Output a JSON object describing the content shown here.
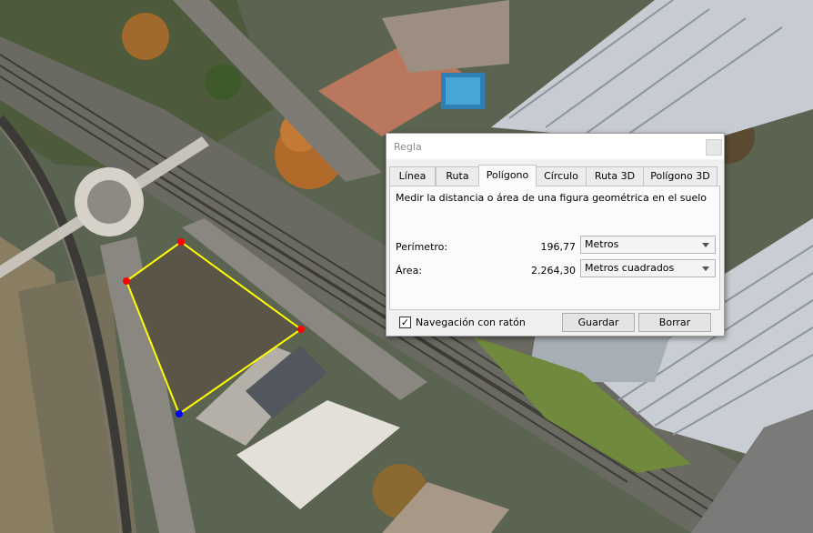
{
  "dialog": {
    "title": "Regla",
    "tabs": [
      {
        "label": "Línea",
        "active": false
      },
      {
        "label": "Ruta",
        "active": false
      },
      {
        "label": "Polígono",
        "active": true
      },
      {
        "label": "Círculo",
        "active": false
      },
      {
        "label": "Ruta 3D",
        "active": false
      },
      {
        "label": "Polígono 3D",
        "active": false
      }
    ],
    "description": "Medir la distancia o área de una figura geométrica en el suelo",
    "perimeter": {
      "label": "Perímetro:",
      "value": "196,77",
      "unit": "Metros"
    },
    "area": {
      "label": "Área:",
      "value": "2.264,30",
      "unit": "Metros cuadrados"
    },
    "mouse_nav": {
      "label": "Navegación con ratón",
      "checked": true
    },
    "save_label": "Guardar",
    "clear_label": "Borrar"
  },
  "polygon": {
    "line_color": "#ffff00",
    "vertex_color": "#ff0000",
    "last_vertex_color": "#0000ff"
  }
}
